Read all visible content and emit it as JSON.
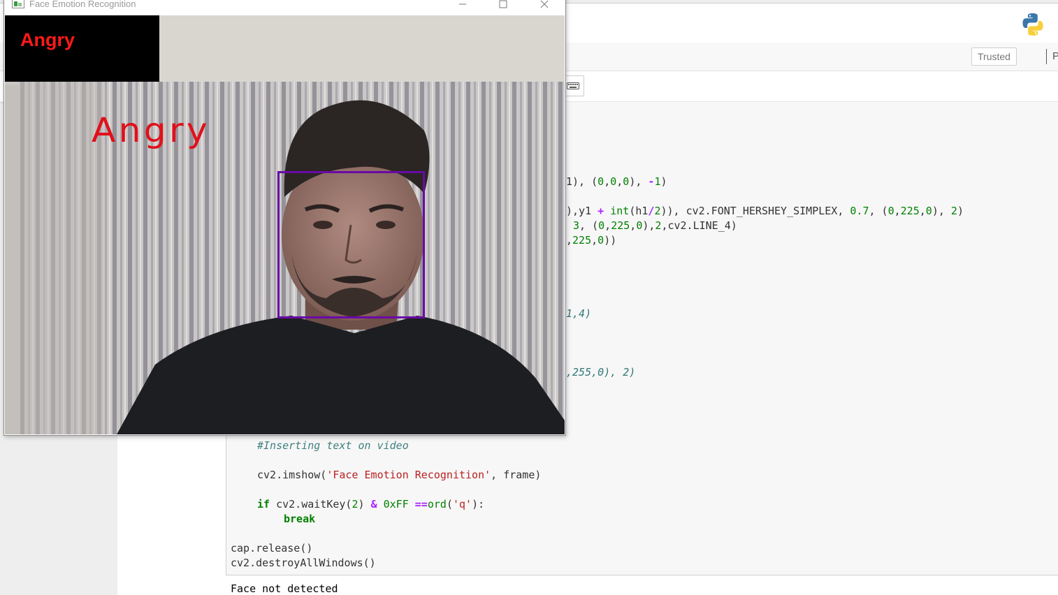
{
  "cv_window": {
    "title": "Face Emotion Recognition",
    "label_box_text": "Angry",
    "overlay_text": "Angry",
    "label_color": "#ff1a1a",
    "face_box_color": "#6a0aa6"
  },
  "toolbar": {
    "trusted_label": "Trusted",
    "kernel_letter": "P"
  },
  "code_visible": {
    "l1": "1), (0,0,0), -1)",
    "l2a": "),y1 + int(h1/2)), cv2.FONT_HERSHEY_SIMPLEX, 0.7, (0,225,0), 2)",
    "l3": "3, (0,225,0),2,cv2.LINE_4)",
    "l4": ",225,0))",
    "l5": "1,4)",
    "l6": ",255,0), 2)",
    "comment": "#Inserting text on video",
    "imshow": "cv2.imshow('Face Emotion Recognition', frame)",
    "if_line": "if cv2.waitKey(2) & 0xFF ==ord('q'):",
    "break": "break",
    "release": "cap.release()",
    "destroy": "cv2.destroyAllWindows()"
  },
  "output": {
    "text": "Face not detected"
  },
  "icons": {
    "python_logo": "python-logo-icon",
    "keyboard": "keyboard-icon",
    "minimize": "minimize-icon",
    "maximize": "maximize-icon",
    "close": "close-icon"
  }
}
